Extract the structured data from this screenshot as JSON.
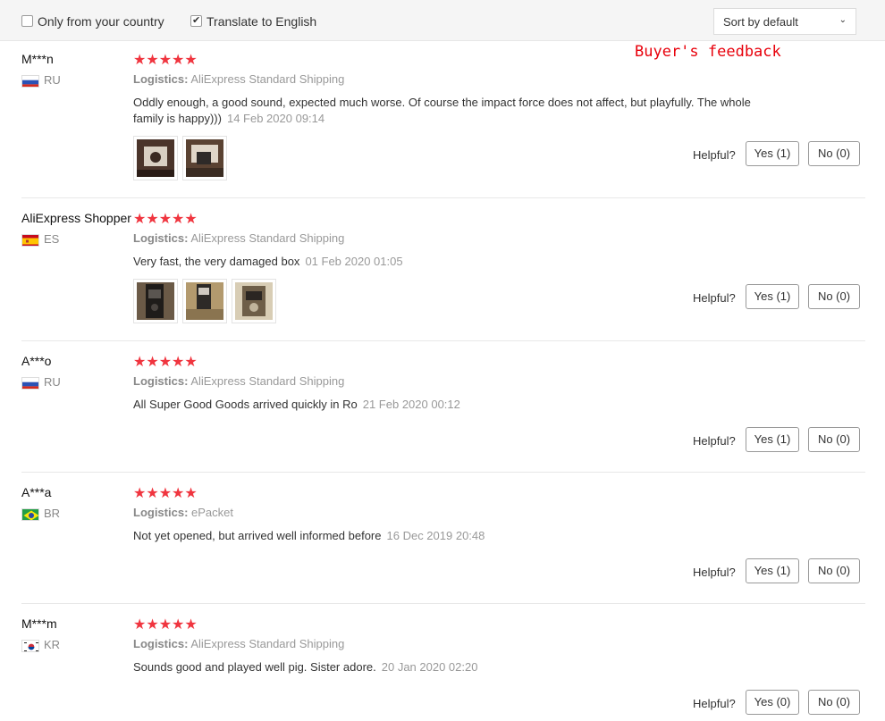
{
  "filters": {
    "only_country_label": "Only from your country",
    "only_country_checked": false,
    "translate_label": "Translate to English",
    "translate_checked": true,
    "sort_value": "Sort by default"
  },
  "annotation": "Buyer's feedback",
  "helpful_label": "Helpful?",
  "logistics_label": "Logistics:",
  "reviews": [
    {
      "name": "M***n",
      "country": "RU",
      "stars": "★★★★★",
      "rating": 5,
      "logistics": "AliExpress Standard Shipping",
      "comment": "Oddly enough, a good sound, expected much worse. Of course the impact force does not affect, but playfully. The whole family is happy)))",
      "date": "14 Feb 2020 09:14",
      "photos": 2,
      "yes": "Yes (1)",
      "no": "No (0)"
    },
    {
      "name": "AliExpress Shopper",
      "country": "ES",
      "stars": "★★★★★",
      "rating": 5,
      "logistics": "AliExpress Standard Shipping",
      "comment": "Very fast, the very damaged box",
      "date": "01 Feb 2020 01:05",
      "photos": 3,
      "yes": "Yes (1)",
      "no": "No (0)"
    },
    {
      "name": "A***o",
      "country": "RU",
      "stars": "★★★★★",
      "rating": 5,
      "logistics": "AliExpress Standard Shipping",
      "comment": "All Super Good Goods arrived quickly in Ro",
      "date": "21 Feb 2020 00:12",
      "photos": 0,
      "yes": "Yes (1)",
      "no": "No (0)"
    },
    {
      "name": "A***a",
      "country": "BR",
      "stars": "★★★★★",
      "rating": 5,
      "logistics": "ePacket",
      "comment": "Not yet opened, but arrived well informed before",
      "date": "16 Dec 2019 20:48",
      "photos": 0,
      "yes": "Yes (1)",
      "no": "No (0)"
    },
    {
      "name": "M***m",
      "country": "KR",
      "stars": "★★★★★",
      "rating": 5,
      "logistics": "AliExpress Standard Shipping",
      "comment": "Sounds good and played well pig. Sister adore.",
      "date": "20 Jan 2020 02:20",
      "photos": 0,
      "yes": "Yes (0)",
      "no": "No (0)"
    }
  ],
  "colors": {
    "star": "#f0353f",
    "annotation": "#e8000b",
    "muted_text": "#999999"
  }
}
